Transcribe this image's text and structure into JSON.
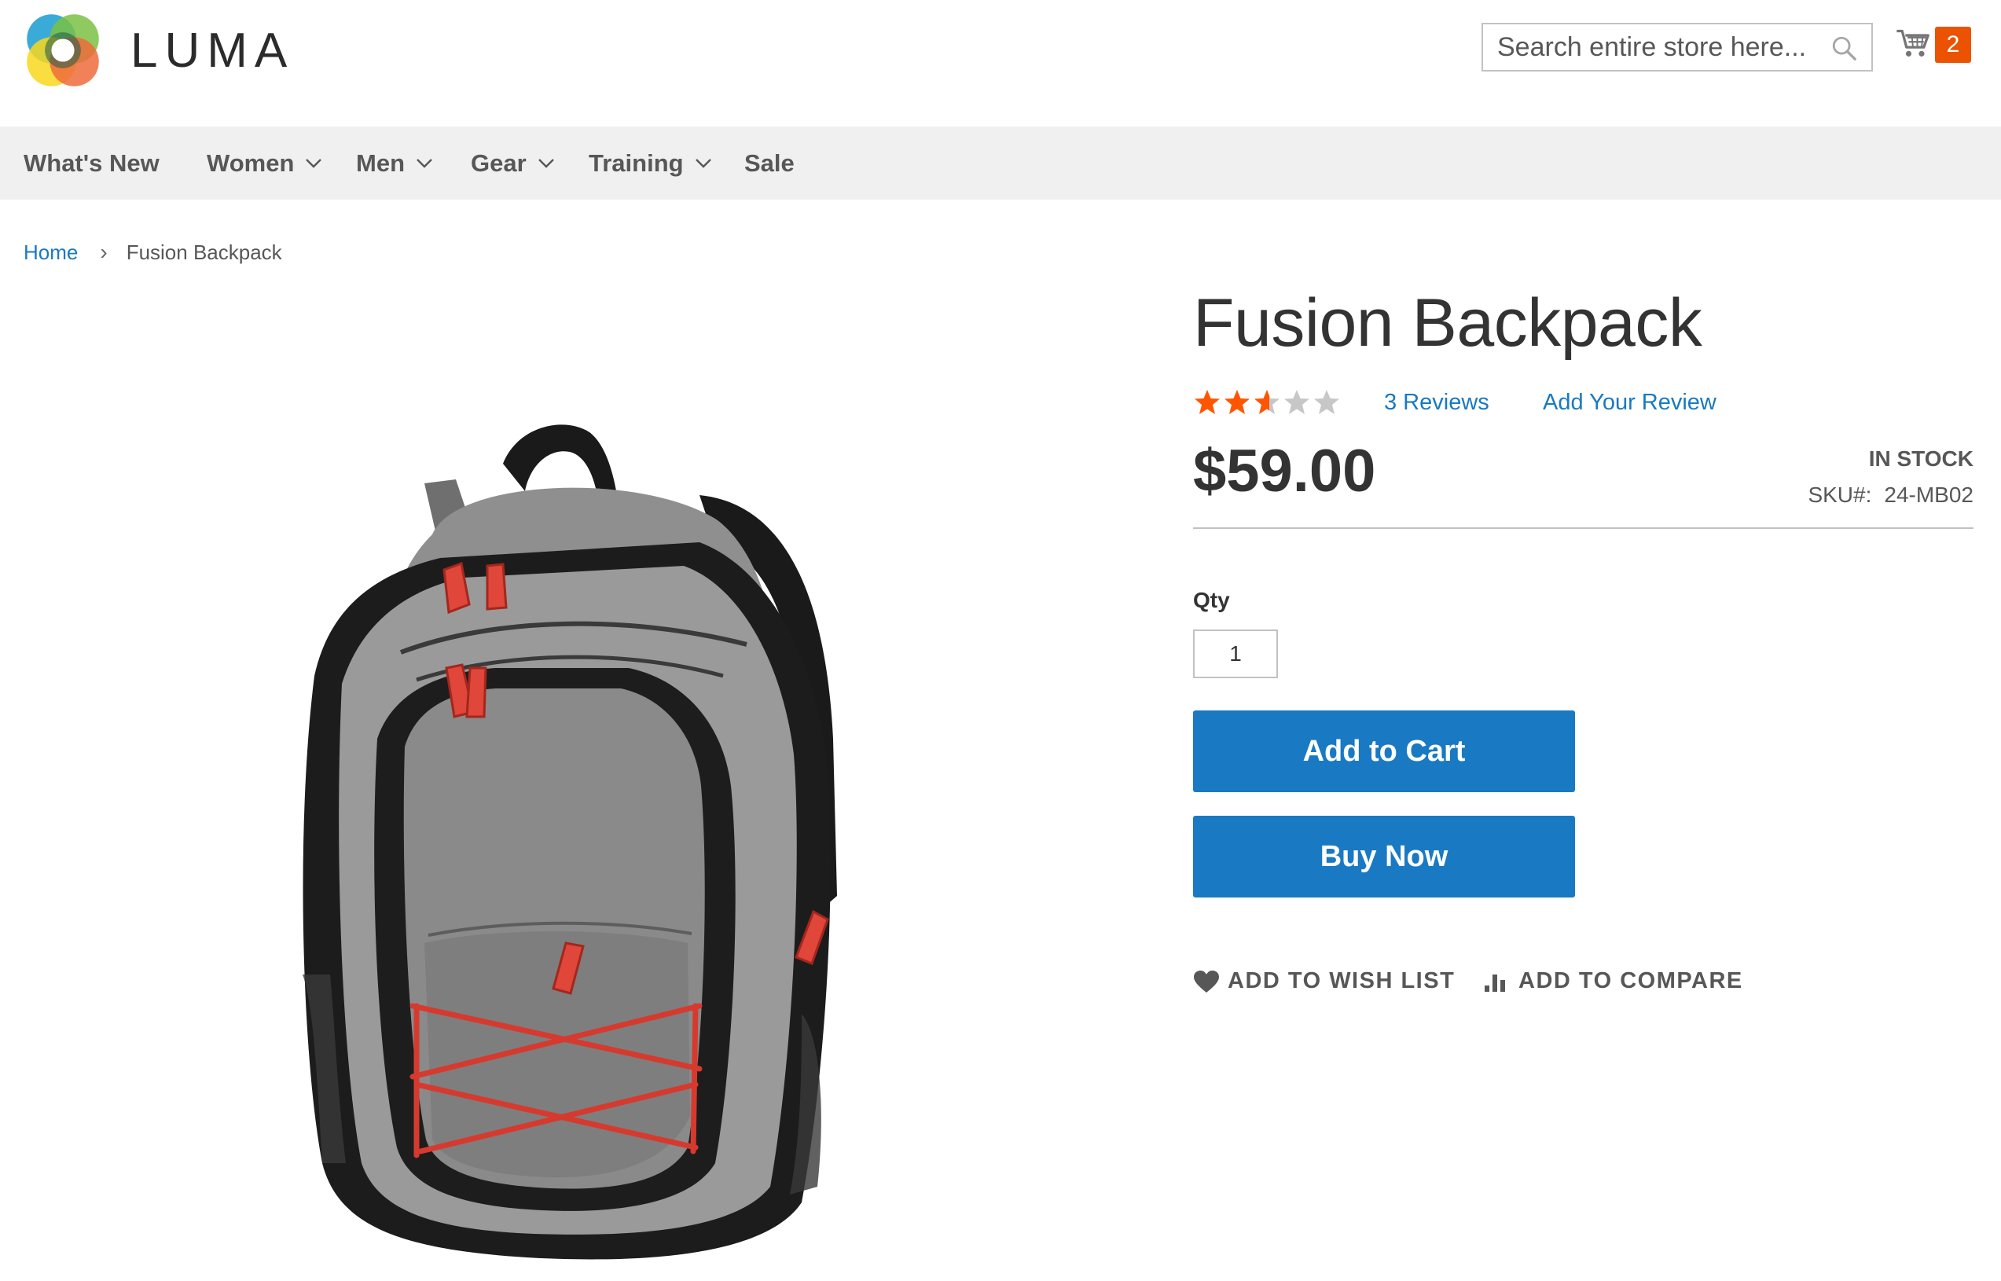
{
  "header": {
    "logo_text": "LUMA",
    "search_placeholder": "Search entire store here...",
    "cart_count": "2",
    "colors": {
      "badge": "#eb5202",
      "link": "#1979c3"
    }
  },
  "nav": {
    "items": [
      {
        "label": "What's New",
        "has_dropdown": false
      },
      {
        "label": "Women",
        "has_dropdown": true
      },
      {
        "label": "Men",
        "has_dropdown": true
      },
      {
        "label": "Gear",
        "has_dropdown": true
      },
      {
        "label": "Training",
        "has_dropdown": true
      },
      {
        "label": "Sale",
        "has_dropdown": false
      }
    ]
  },
  "breadcrumb": {
    "home": "Home",
    "current": "Fusion Backpack"
  },
  "product": {
    "name": "Fusion Backpack",
    "rating": 2.6,
    "rating_max": 5,
    "reviews_link": "3  Reviews",
    "add_review": "Add Your Review",
    "price": "$59.00",
    "stock": "IN STOCK",
    "sku_label": "SKU#:",
    "sku": "24-MB02",
    "qty_label": "Qty",
    "qty_value": "1",
    "add_to_cart": "Add to Cart",
    "buy_now": "Buy Now",
    "wish_list": "ADD TO WISH LIST",
    "compare": "ADD TO COMPARE"
  }
}
